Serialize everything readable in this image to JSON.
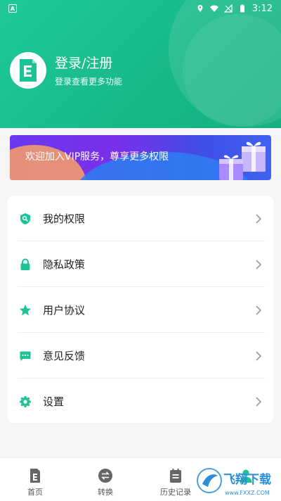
{
  "status_bar": {
    "time": "3:12",
    "left_badge": "A"
  },
  "header": {
    "avatar_letter": "E",
    "title": "登录/注册",
    "subtitle": "登录查看更多功能"
  },
  "vip_banner": {
    "text": "欢迎加入VIP服务，尊享更多权限"
  },
  "menu": {
    "items": [
      {
        "label": "我的权限",
        "icon": "shield-key-icon"
      },
      {
        "label": "隐私政策",
        "icon": "lock-icon"
      },
      {
        "label": "用户协议",
        "icon": "star-icon"
      },
      {
        "label": "意见反馈",
        "icon": "chat-icon"
      },
      {
        "label": "设置",
        "icon": "gear-icon"
      }
    ]
  },
  "tabbar": {
    "tabs": [
      {
        "label": "首页",
        "icon": "document-icon"
      },
      {
        "label": "转换",
        "icon": "convert-icon"
      },
      {
        "label": "历史记录",
        "icon": "calendar-icon"
      },
      {
        "label": "",
        "icon": "profile-icon"
      }
    ]
  },
  "watermark": {
    "text": "飞翔下载",
    "sub": "www.FXXZ.COM"
  },
  "colors": {
    "brand_green": "#1ec297",
    "accent_green": "#19b98a",
    "vip_purple": "#6a39f0"
  }
}
